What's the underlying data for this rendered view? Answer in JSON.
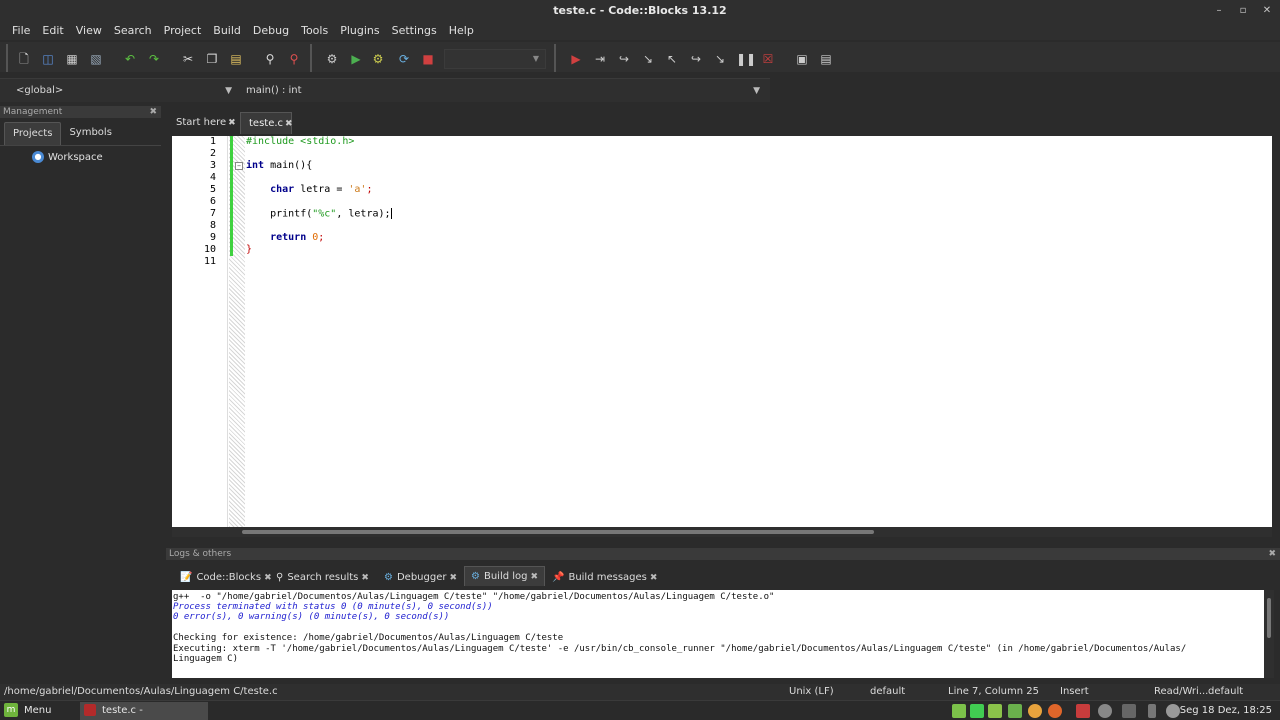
{
  "window": {
    "title": "teste.c - Code::Blocks 13.12"
  },
  "menubar": [
    "File",
    "Edit",
    "View",
    "Search",
    "Project",
    "Build",
    "Debug",
    "Tools",
    "Plugins",
    "Settings",
    "Help"
  ],
  "code_completion": {
    "scope": "<global>",
    "symbol": "main() : int"
  },
  "management": {
    "title": "Management",
    "tabs": [
      "Projects",
      "Symbols"
    ],
    "workspace_label": "Workspace"
  },
  "editor_tabs": [
    "Start here",
    "teste.c"
  ],
  "editor": {
    "line_numbers": [
      "1",
      "2",
      "3",
      "4",
      "5",
      "6",
      "7",
      "8",
      "9",
      "10",
      "11"
    ],
    "lines": {
      "l1": "#include <stdio.h>",
      "l3_kw": "int",
      "l3_rest": " main(){",
      "l5_kw": "char",
      "l5_mid": " letra = ",
      "l5_chr": "'a'",
      "l5_end": ";",
      "l7_a": "printf(",
      "l7_str": "\"%c\"",
      "l7_b": ", letra);",
      "l9_kw": "return",
      "l9_sp": " ",
      "l9_num": "0",
      "l9_end": ";",
      "l11": "}"
    }
  },
  "logs": {
    "title": "Logs & others",
    "tabs": [
      "Code::Blocks",
      "Search results",
      "Debugger",
      "Build log",
      "Build messages"
    ],
    "lines": [
      "g++  -o \"/home/gabriel/Documentos/Aulas/Linguagem C/teste\" \"/home/gabriel/Documentos/Aulas/Linguagem C/teste.o\"",
      "Process terminated with status 0 (0 minute(s), 0 second(s))",
      "0 error(s), 0 warning(s) (0 minute(s), 0 second(s))",
      "",
      "Checking for existence: /home/gabriel/Documentos/Aulas/Linguagem C/teste",
      "Executing: xterm -T '/home/gabriel/Documentos/Aulas/Linguagem C/teste' -e /usr/bin/cb_console_runner \"/home/gabriel/Documentos/Aulas/Linguagem C/teste\" (in /home/gabriel/Documentos/Aulas/",
      "Linguagem C)"
    ]
  },
  "statusbar": {
    "path": "/home/gabriel/Documentos/Aulas/Linguagem C/teste.c",
    "eol": "Unix (LF)",
    "encoding": "default",
    "position": "Line 7, Column 25",
    "mode": "Insert",
    "rw": "Read/Wri...",
    "profile": "default"
  },
  "taskbar": {
    "menu_label": "Menu",
    "task_label": "teste.c - Code::Block...",
    "clock": "Seg 18 Dez, 18:25"
  }
}
